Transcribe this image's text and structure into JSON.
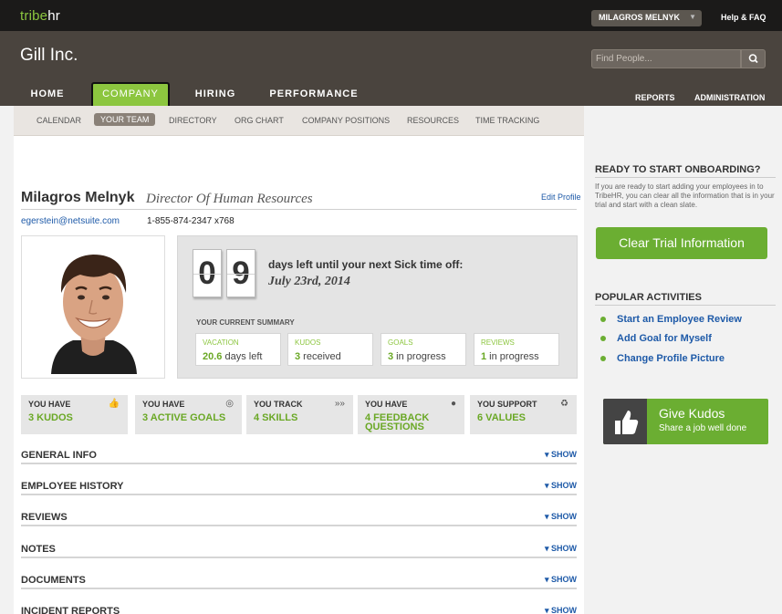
{
  "topbar": {
    "brand_a": "tribe",
    "brand_b": "hr",
    "user": "MILAGROS MELNYK",
    "help": "Help & FAQ"
  },
  "header": {
    "company": "Gill Inc.",
    "search_placeholder": "Find People..."
  },
  "nav": {
    "tabs": [
      "HOME",
      "COMPANY",
      "HIRING",
      "PERFORMANCE"
    ],
    "active": "COMPANY",
    "right": [
      "REPORTS",
      "ADMINISTRATION"
    ]
  },
  "subnav": {
    "items": [
      "CALENDAR",
      "YOUR TEAM",
      "DIRECTORY",
      "ORG CHART",
      "COMPANY POSITIONS",
      "RESOURCES",
      "TIME TRACKING"
    ],
    "active": "YOUR TEAM"
  },
  "profile": {
    "name": "Milagros Melnyk",
    "title": "Director Of Human Resources",
    "edit": "Edit Profile",
    "email": "egerstein@netsuite.com",
    "phone": "1-855-874-2347 x768"
  },
  "sick": {
    "digit1": "0",
    "digit2": "9",
    "line": "days left until your next Sick time off:",
    "date": "July 23rd, 2014"
  },
  "summary": {
    "label": "YOUR CURRENT SUMMARY",
    "cards": [
      {
        "title": "VACATION",
        "value": "20.6",
        "rest": " days left"
      },
      {
        "title": "KUDOS",
        "value": "3",
        "rest": " received"
      },
      {
        "title": "GOALS",
        "value": "3",
        "rest": " in progress"
      },
      {
        "title": "REVIEWS",
        "value": "1",
        "rest": " in progress"
      }
    ]
  },
  "stats": [
    {
      "label": "YOU HAVE",
      "value": "3 KUDOS",
      "icon": "thumbs-up-icon"
    },
    {
      "label": "YOU HAVE",
      "value": "3 ACTIVE GOALS",
      "icon": "target-icon"
    },
    {
      "label": "YOU TRACK",
      "value": "4 SKILLS",
      "icon": "chevrons-icon"
    },
    {
      "label": "YOU HAVE",
      "value": "4 FEEDBACK QUESTIONS",
      "icon": "speech-bubble-icon"
    },
    {
      "label": "YOU SUPPORT",
      "value": "6 VALUES",
      "icon": "recycle-icon"
    }
  ],
  "sections": [
    "GENERAL INFO",
    "EMPLOYEE HISTORY",
    "REVIEWS",
    "NOTES",
    "DOCUMENTS",
    "INCIDENT REPORTS"
  ],
  "show_label": "▾ SHOW",
  "onboarding": {
    "title": "READY TO START ONBOARDING?",
    "desc": "If you are ready to start adding your employees in to TribeHR, you can clear all the information that is in your trial and start with a clean slate.",
    "button": "Clear Trial Information"
  },
  "popular": {
    "title": "POPULAR ACTIVITIES",
    "items": [
      "Start an Employee Review",
      "Add Goal for Myself",
      "Change Profile Picture"
    ]
  },
  "kudos": {
    "title": "Give Kudos",
    "subtitle": "Share a job well done"
  },
  "colors": {
    "accent": "#8cc63f",
    "link": "#1e5aa8",
    "header": "#4a443e",
    "topbar": "#1b1a19"
  }
}
